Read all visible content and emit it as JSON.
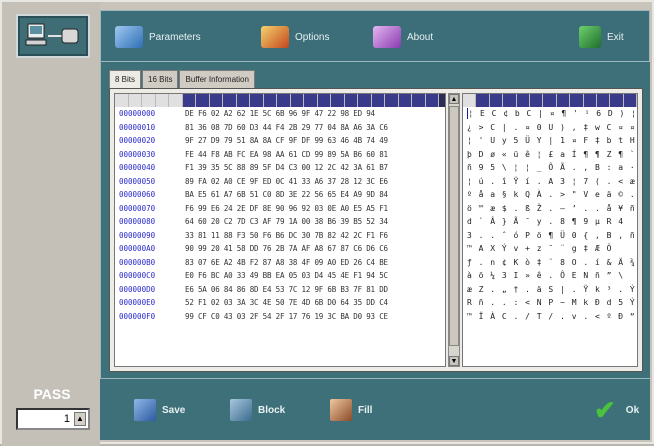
{
  "toolbar": {
    "parameters": "Parameters",
    "options": "Options",
    "about": "About",
    "exit": "Exit"
  },
  "tabs": [
    "8 Bits",
    "16 Bits",
    "Buffer Information"
  ],
  "hex_rows": [
    {
      "addr": "00000000",
      "bytes": "DE F6 02 A2 62 1E 5C 6B 96 9F 47 22 98 ED 94"
    },
    {
      "addr": "00000010",
      "bytes": "81 36 08 7D 60 D3 44 F4 2B 29 77 04 8A A6 3A C6"
    },
    {
      "addr": "00000020",
      "bytes": "9F 27 D9 79 51 8A 8A CF 9F DF 99 63 46 4B 74 49"
    },
    {
      "addr": "00000030",
      "bytes": "FE 44 F8 AB FC EA 98 AA 61 CD 99 89 5A B6 60 81"
    },
    {
      "addr": "00000040",
      "bytes": "F1 39 35 5C 88 89 5F D4 C3 00 12 2C 42 3A 61 B7"
    },
    {
      "addr": "00000050",
      "bytes": "89 FA 02 A0 CE 9F ED 0C 41 33 A6 37 28 12 3C E6"
    },
    {
      "addr": "00000060",
      "bytes": "BA E5 61 A7 6B 51 C0 8D 3E 22 56 65 E4 A9 9D 84"
    },
    {
      "addr": "00000070",
      "bytes": "F6 99 E6 24 2E DF 8E 90 96 92 03 0E A0 E5 A5 F1"
    },
    {
      "addr": "00000080",
      "bytes": "64 60 20 C2 7D C3 AF 79 1A 00 38 B6 39 B5 52 34"
    },
    {
      "addr": "00000090",
      "bytes": "33 81 11 88 F3 50 F6 B6 DC 30 7B 82 42 2C F1 F6"
    },
    {
      "addr": "000000A0",
      "bytes": "90 99 20 41 58 DD 76 2B 7A AF A8 67 87 C6 D6 C6"
    },
    {
      "addr": "000000B0",
      "bytes": "83 07 6E A2 4B F2 87 A8 38 4F 09 A0 ED 26 C4 BE"
    },
    {
      "addr": "000000C0",
      "bytes": "E0 F6 BC A0 33 49 BB EA 05 03 D4 45 4E F1 94 5C"
    },
    {
      "addr": "000000D0",
      "bytes": "E6 5A 06 84 86 8D E4 53 7C 12 9F 6B B3 7F 81 DD"
    },
    {
      "addr": "000000E0",
      "bytes": "52 F1 02 03 3A 3C 4E 50 7E 4D 6B D0 64 35 DD C4"
    },
    {
      "addr": "000000F0",
      "bytes": "99 CF C0 43 03 2F 54 2F 17 76 19 3C BA D0 93 CE"
    }
  ],
  "ascii_rows": [
    "¦  E C ¢ b C | ¤ ¶ ' ¹ 6 D ) ¦",
    "¿ > C | . ¤ 0 U ) , ‡ w C ¤ ¤ . C 8",
    "¦ ' U y 5 Ü Y  | 1 ¤ F ‡ b t H l",
    "þ D ø « ü ê ¦ £ a Í ¶ ¶ Z ¶ ` ¦",
    "ñ 9 5 \\ ¦ ¦ _ Ô Ã . , B : a ·",
    "¦ ú . î Ÿ í . A 3 ¦ 7 ( . < æ",
    "º å a § k Q À . > \" V e ä © .",
    "ö ™ æ $ . ß Ž . – ’ . . å ¥ ñ",
    "d ` Â } Ã ¯ y . 8 ¶ 9 µ R 4",
    "3 . . ˆ ó P ö ¶ Ü 0 { ‚ B , ñ ö",
    "  ™  A X Ý v + z ¯ ¨ g ‡ Æ Ö",
    "ƒ . n ¢ K ò ‡ ¨ 8 O . í & Ä ¾",
    "à ö ¼ 3 I » ê . Ô E N ñ ” \\",
    "æ Z . „ † . ä S | . Ÿ k ³ . Ý",
    "R ñ . . : < N P ~ M k Ð d 5 Ý Ä",
    "™ Ï À C . / T / . v . < º Ð “ Î"
  ],
  "bottom": {
    "save": "Save",
    "block": "Block",
    "fill": "Fill",
    "ok": "Ok"
  },
  "pass": {
    "label": "PASS",
    "value": "1"
  }
}
